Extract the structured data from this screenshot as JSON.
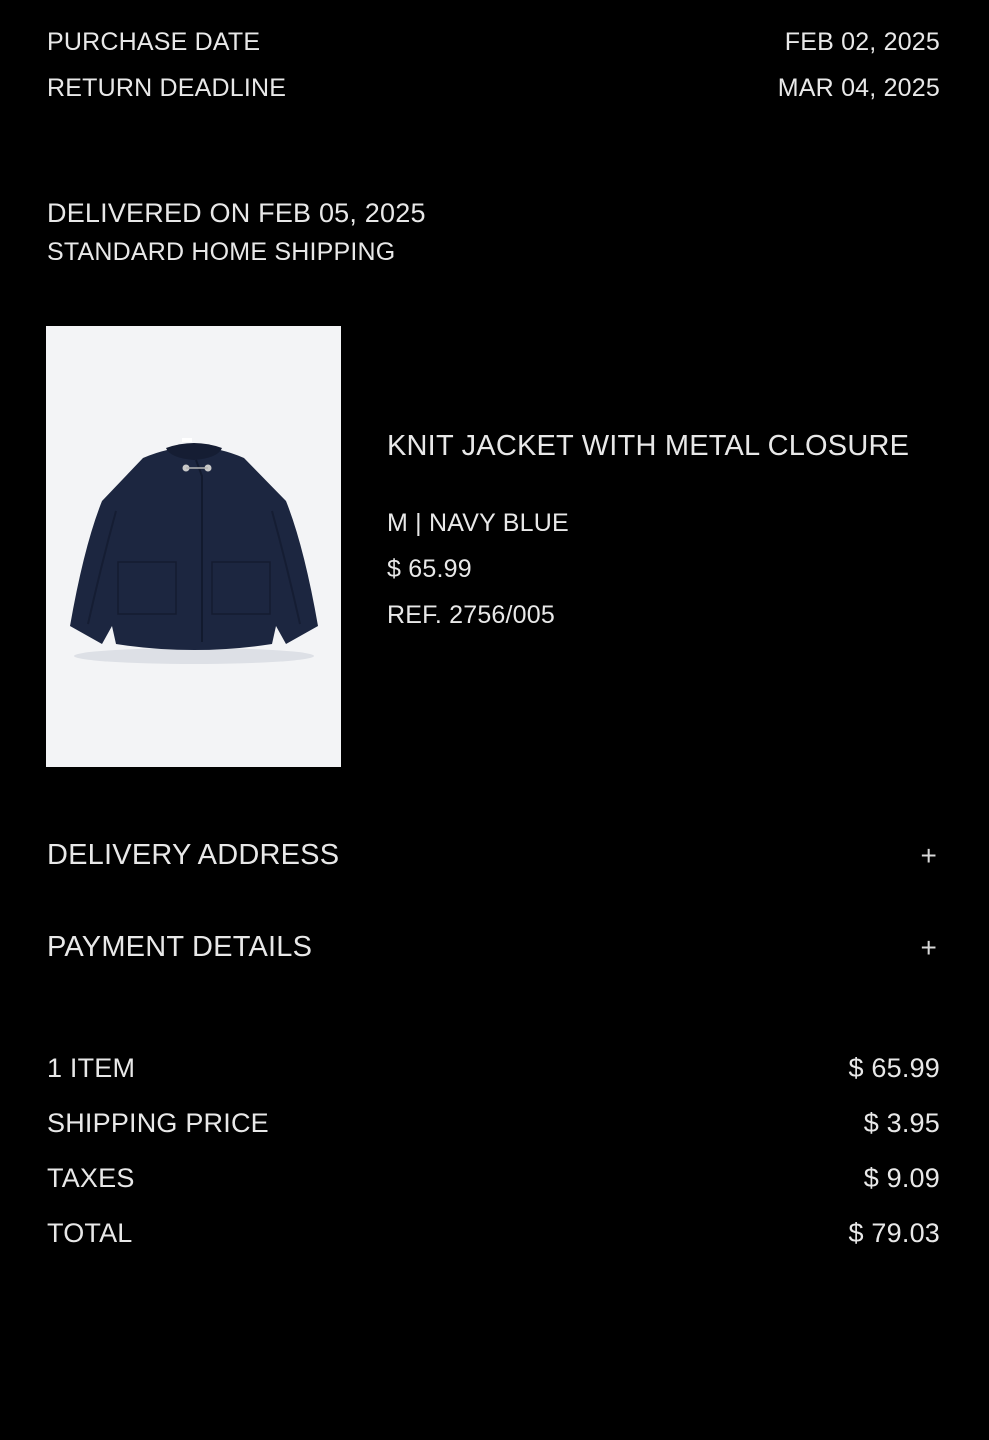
{
  "dates": {
    "purchase_label": "PURCHASE DATE",
    "purchase_value": "FEB 02, 2025",
    "return_label": "RETURN DEADLINE",
    "return_value": "MAR 04, 2025"
  },
  "delivery": {
    "status": "DELIVERED ON FEB 05, 2025",
    "method": "STANDARD HOME SHIPPING"
  },
  "product": {
    "name": "KNIT JACKET WITH METAL CLOSURE",
    "variant": "M | NAVY BLUE",
    "price": "$ 65.99",
    "ref": "REF. 2756/005",
    "image_icon": "navy-knit-jacket-photo"
  },
  "sections": {
    "delivery_address": "DELIVERY ADDRESS",
    "payment_details": "PAYMENT DETAILS",
    "expand_symbol": "+"
  },
  "summary": {
    "items_label": "1 ITEM",
    "items_value": "$ 65.99",
    "shipping_label": "SHIPPING PRICE",
    "shipping_value": "$ 3.95",
    "taxes_label": "TAXES",
    "taxes_value": "$ 9.09",
    "total_label": "TOTAL",
    "total_value": "$ 79.03"
  },
  "colors": {
    "background": "#000000",
    "text": "#e8e8e8",
    "product_image_bg": "#f3f4f6",
    "jacket": "#1c2640"
  }
}
